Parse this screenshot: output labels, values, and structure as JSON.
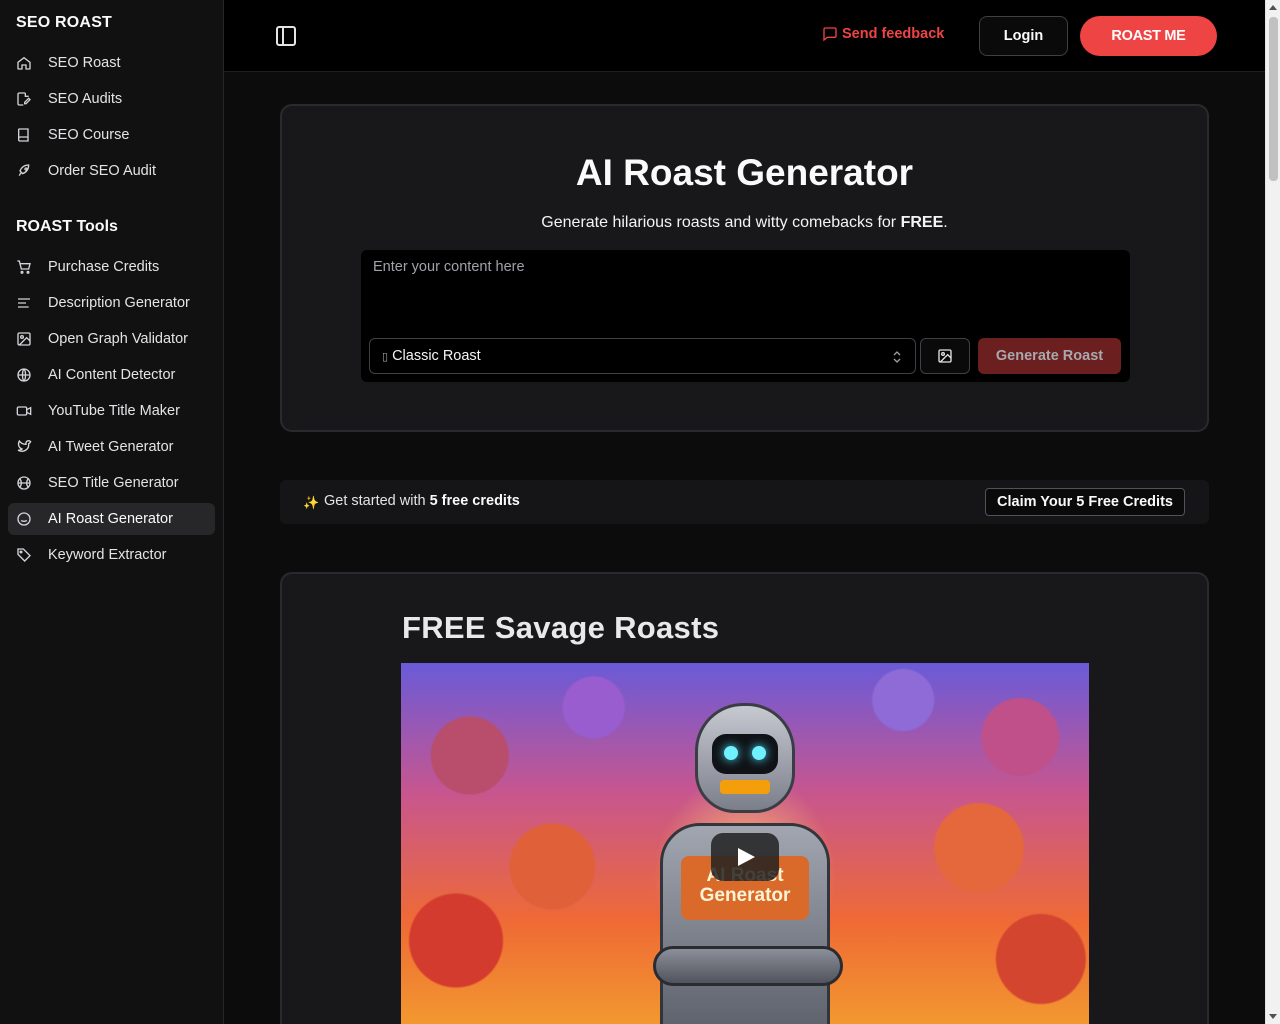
{
  "sidebar": {
    "brand": "SEO ROAST",
    "primary_items": [
      {
        "label": "SEO Roast",
        "icon": "home-icon"
      },
      {
        "label": "SEO Audits",
        "icon": "audit-icon"
      },
      {
        "label": "SEO Course",
        "icon": "book-icon"
      },
      {
        "label": "Order SEO Audit",
        "icon": "rocket-icon"
      }
    ],
    "section_title": "ROAST Tools",
    "tool_items": [
      {
        "label": "Purchase Credits",
        "icon": "cart-icon"
      },
      {
        "label": "Description Generator",
        "icon": "text-lines-icon"
      },
      {
        "label": "Open Graph Validator",
        "icon": "image-icon"
      },
      {
        "label": "AI Content Detector",
        "icon": "globe-icon"
      },
      {
        "label": "YouTube Title Maker",
        "icon": "video-icon"
      },
      {
        "label": "AI Tweet Generator",
        "icon": "twitter-icon"
      },
      {
        "label": "SEO Title Generator",
        "icon": "basketball-icon"
      },
      {
        "label": "AI Roast Generator",
        "icon": "smile-icon",
        "active": true
      },
      {
        "label": "Keyword Extractor",
        "icon": "tag-icon"
      }
    ]
  },
  "header": {
    "feedback_label": "Send feedback",
    "login_label": "Login",
    "roast_label": "ROAST ME"
  },
  "hero": {
    "title": "AI Roast Generator",
    "subtitle_prefix": "Generate hilarious roasts and witty comebacks for ",
    "subtitle_bold": "FREE",
    "subtitle_suffix": ".",
    "input_placeholder": "Enter your content here",
    "input_value": "",
    "style_select": "Classic Roast",
    "generate_label": "Generate Roast"
  },
  "banner": {
    "text_prefix": "Get started with ",
    "text_bold": "5 free credits",
    "claim_label": "Claim Your 5 Free Credits"
  },
  "video_section": {
    "heading": "FREE Savage Roasts",
    "thumbnail_text_line1": "AI Roast",
    "thumbnail_text_line2": "Generator"
  },
  "colors": {
    "accent": "#ef4444",
    "background": "#0c0c0d",
    "card": "#18181b",
    "sidebar": "#111112"
  }
}
